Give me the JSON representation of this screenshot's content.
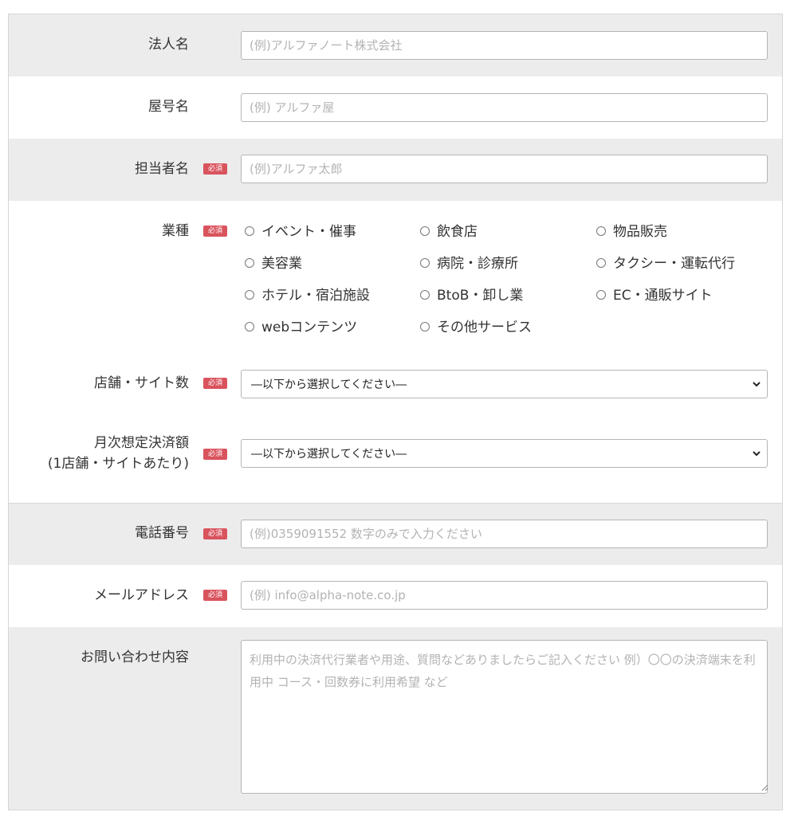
{
  "required_badge": "必須",
  "fields": {
    "corporate_name": {
      "label": "法人名",
      "placeholder": "(例)アルファノート株式会社"
    },
    "trade_name": {
      "label": "屋号名",
      "placeholder": "(例) アルファ屋"
    },
    "contact_name": {
      "label": "担当者名",
      "placeholder": "(例)アルファ太郎"
    },
    "industry": {
      "label": "業種",
      "options": [
        "イベント・催事",
        "飲食店",
        "物品販売",
        "美容業",
        "病院・診療所",
        "タクシー・運転代行",
        "ホテル・宿泊施設",
        "BtoB・卸し業",
        "EC・通販サイト",
        "webコンテンツ",
        "その他サービス"
      ]
    },
    "store_count": {
      "label": "店舗・サイト数",
      "selected": "―以下から選択してください―"
    },
    "monthly_amount": {
      "label_line1": "月次想定決済額",
      "label_line2": "(1店舗・サイトあたり)",
      "selected": "―以下から選択してください―"
    },
    "phone": {
      "label": "電話番号",
      "placeholder": "(例)0359091552 数字のみで入力ください"
    },
    "email": {
      "label": "メールアドレス",
      "placeholder": "(例) info@alpha-note.co.jp"
    },
    "inquiry": {
      "label": "お問い合わせ内容",
      "placeholder": "利用中の決済代行業者や用途、質問などありましたらご記入ください 例）〇〇の決済端末を利用中 コース・回数券に利用希望 など"
    }
  },
  "colors": {
    "row_gray": "#ececec",
    "badge_red": "#d9535d",
    "border": "#b5b5b5"
  },
  "icons": {
    "select_arrow": "chevron-down-icon",
    "radio": "radio-empty-icon",
    "resize": "resize-grip-icon"
  }
}
